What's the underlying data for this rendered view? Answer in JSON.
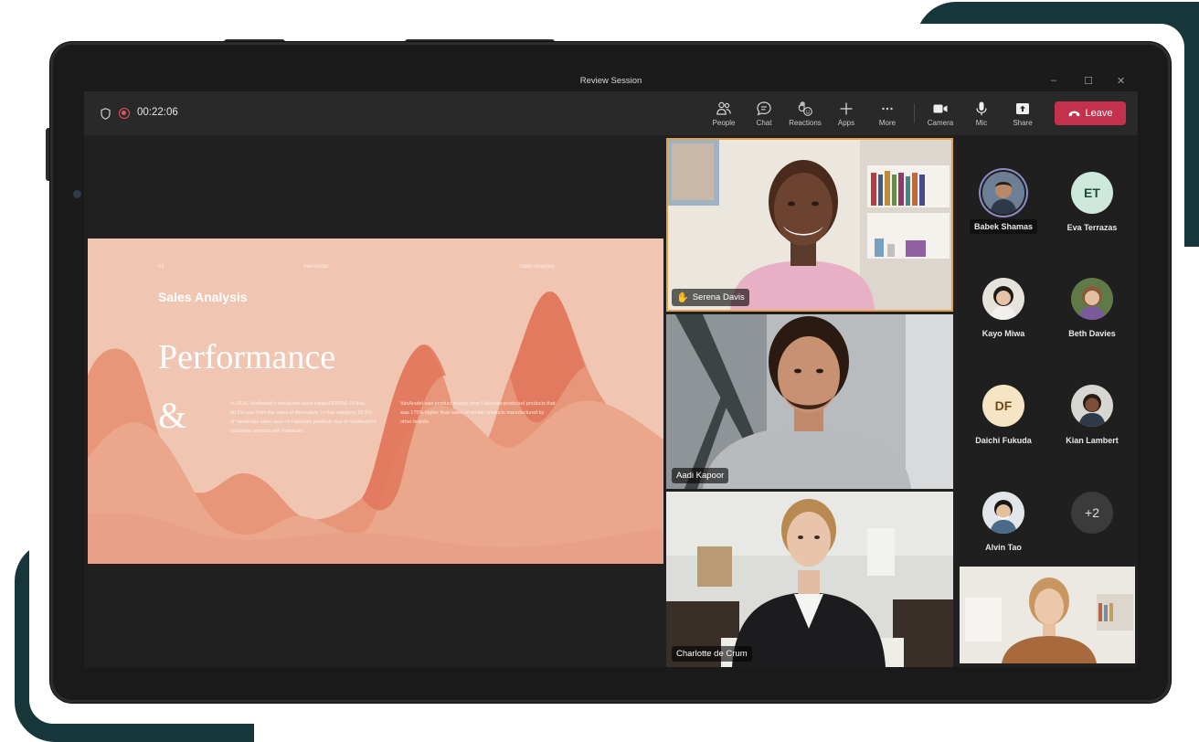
{
  "window": {
    "title": "Review Session",
    "controls": [
      "–",
      "☐",
      "✕"
    ]
  },
  "call": {
    "elapsed": "00:22:06"
  },
  "toolbar": {
    "people": "People",
    "chat": "Chat",
    "reactions": "Reactions",
    "apps": "Apps",
    "more": "More",
    "camera": "Camera",
    "mic": "Mic",
    "share": "Share",
    "leave": "Leave"
  },
  "slide": {
    "number": "01",
    "brand": "VanArsdel",
    "section_tag": "Sales Analysis",
    "section": "Sales Analysis",
    "title": "Performance",
    "ampersand": "&",
    "body_1": "In 2019, VanArsdel's worldwide sales topped $000M. Of that, 60.2% was from the sales of decorative. In that category, 92.5% of VanArsdel sales were of Fabrikam products due to VanArsdel's exclusive contract with Fabrikam.",
    "body_2": "VanArsdel saw product margin from Fabrikam-produced products that was 175% higher than sales of similar products manufactured by other brands."
  },
  "videos": [
    {
      "name": "Serena Davis",
      "raised_hand": true,
      "active": true
    },
    {
      "name": "Aadi Kapoor"
    },
    {
      "name": "Charlotte de Crum"
    }
  ],
  "roster": [
    {
      "name": "Babek Shamas",
      "initials": "",
      "speaking": true
    },
    {
      "name": "Eva Terrazas",
      "initials": "ET"
    },
    {
      "name": "Kayo Miwa",
      "initials": ""
    },
    {
      "name": "Beth Davies",
      "initials": ""
    },
    {
      "name": "Daichi Fukuda",
      "initials": "DF"
    },
    {
      "name": "Kian Lambert",
      "initials": ""
    },
    {
      "name": "Alvin Tao",
      "initials": ""
    },
    {
      "name": "",
      "initials": "+2"
    }
  ],
  "colors": {
    "leave": "#c4314b",
    "active_speaker": "#e0a24b",
    "slide_bg": "#f0c6b3",
    "wave_dark": "#e0775b"
  }
}
